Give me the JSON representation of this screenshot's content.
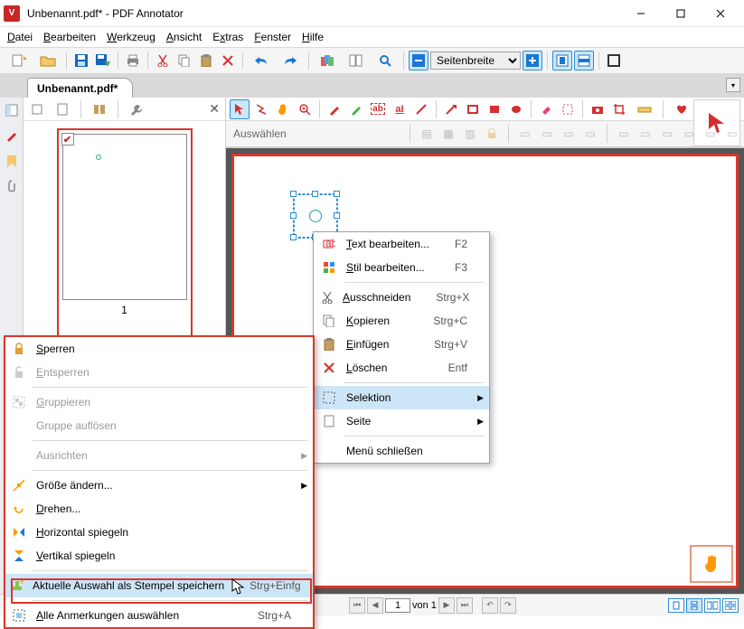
{
  "window": {
    "title": "Unbenannt.pdf* - PDF Annotator"
  },
  "menu": {
    "file": "Datei",
    "edit": "Bearbeiten",
    "tool": "Werkzeug",
    "view": "Ansicht",
    "extras": "Extras",
    "window": "Fenster",
    "help": "Hilfe"
  },
  "toolbar": {
    "zoom_mode": "Seitenbreite"
  },
  "tab": {
    "label": "Unbenannt.pdf*"
  },
  "sidepanel": {
    "page_number": "1"
  },
  "anno2": {
    "mode": "Auswählen"
  },
  "status": {
    "page_input": "1",
    "page_total": "von 1"
  },
  "ctx_main": {
    "edit_text": "Text bearbeiten...",
    "edit_text_sc": "F2",
    "edit_style": "Stil bearbeiten...",
    "edit_style_sc": "F3",
    "cut": "Ausschneiden",
    "cut_sc": "Strg+X",
    "copy": "Kopieren",
    "copy_sc": "Strg+C",
    "paste": "Einfügen",
    "paste_sc": "Strg+V",
    "delete": "Löschen",
    "delete_sc": "Entf",
    "selection": "Selektion",
    "page": "Seite",
    "close": "Menü schließen"
  },
  "ctx_sub": {
    "lock": "Sperren",
    "unlock": "Entsperren",
    "group": "Gruppieren",
    "ungroup": "Gruppe auflösen",
    "align": "Ausrichten",
    "resize": "Größe ändern...",
    "rotate": "Drehen...",
    "fliph": "Horizontal spiegeln",
    "flipv": "Vertikal spiegeln",
    "save_stamp": "Aktuelle Auswahl als Stempel speichern",
    "save_stamp_sc": "Strg+Einfg",
    "select_all": "Alle Anmerkungen auswählen",
    "select_all_sc": "Strg+A"
  }
}
